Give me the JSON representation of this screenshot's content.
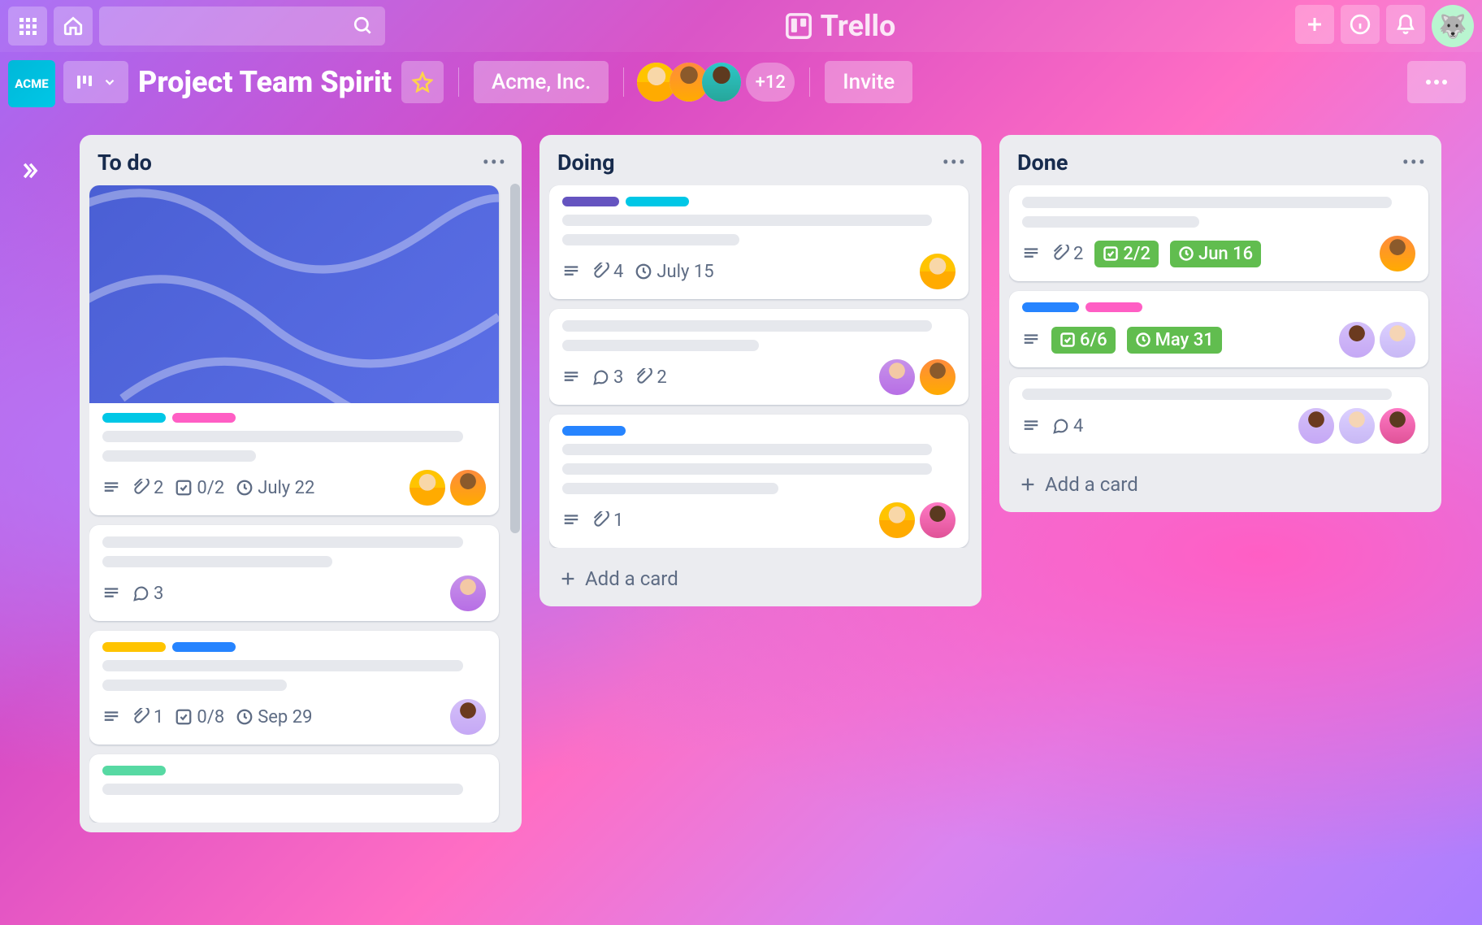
{
  "app": {
    "name": "Trello"
  },
  "header": {
    "workspace_badge": "ACME",
    "board_title": "Project Team Spirit",
    "org_name": "Acme, Inc.",
    "member_overflow": "+12",
    "invite_label": "Invite"
  },
  "lists": [
    {
      "title": "To do",
      "add_card_label": "Add a card",
      "cards": [
        {
          "cover": true,
          "labels": [
            "#00c7e6",
            "#ff5ec4"
          ],
          "attachments": "2",
          "checklist": "0/2",
          "due": "July 22",
          "members": [
            "av-yellow",
            "av-orange"
          ]
        },
        {
          "labels": [],
          "comments": "3",
          "members": [
            "av-purple"
          ]
        },
        {
          "labels": [
            "#ffc400",
            "#2684ff"
          ],
          "attachments": "1",
          "checklist": "0/8",
          "due": "Sep 29",
          "members": [
            "av-lightpurple"
          ]
        },
        {
          "labels": [
            "#57d9a3"
          ],
          "partial": true
        }
      ]
    },
    {
      "title": "Doing",
      "add_card_label": "Add a card",
      "cards": [
        {
          "labels": [
            "#6554c0",
            "#00c7e6"
          ],
          "attachments": "4",
          "due": "July 15",
          "members": [
            "av-yellow"
          ]
        },
        {
          "labels": [],
          "comments": "3",
          "attachments": "2",
          "members": [
            "av-purple",
            "av-orange"
          ]
        },
        {
          "labels": [
            "#2684ff"
          ],
          "attachments": "1",
          "members": [
            "av-yellow",
            "av-pink"
          ]
        }
      ]
    },
    {
      "title": "Done",
      "add_card_label": "Add a card",
      "cards": [
        {
          "labels": [],
          "attachments": "2",
          "checklist": "2/2",
          "checklist_done": true,
          "due": "Jun 16",
          "due_done": true,
          "members": [
            "av-orange"
          ]
        },
        {
          "labels": [
            "#2684ff",
            "#ff5ec4"
          ],
          "checklist": "6/6",
          "checklist_done": true,
          "due": "May 31",
          "due_done": true,
          "members": [
            "av-lightpurple",
            "av-lav"
          ]
        },
        {
          "labels": [],
          "comments": "4",
          "members": [
            "av-lightpurple",
            "av-lav",
            "av-pink"
          ]
        }
      ]
    }
  ]
}
